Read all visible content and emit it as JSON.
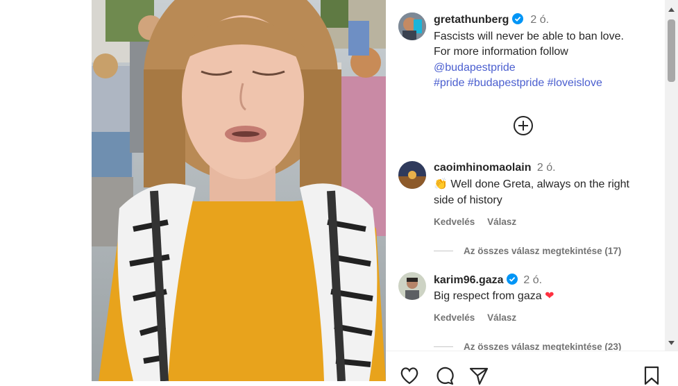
{
  "post": {
    "author": "gretathunberg",
    "time": "2 ó.",
    "caption_line1": "Fascists will never be able to ban love.",
    "caption_line2": "For more information follow",
    "mention": "@budapestpride",
    "hashtags": "#pride #budapestpride #loveislove"
  },
  "comments": [
    {
      "user": "caoimhinomaolain",
      "time": "2 ó.",
      "emoji": "👏",
      "text_line1": "Well done Greta, always on the right",
      "text_line2": "side of history",
      "like_label": "Kedvelés",
      "reply_label": "Válasz",
      "view_replies": "Az összes válasz megtekintése (17)"
    },
    {
      "user": "karim96.gaza",
      "time": "2 ó.",
      "text": "Big respect from gaza",
      "emoji": "❤",
      "like_label": "Kedvelés",
      "reply_label": "Válasz",
      "view_replies": "Az összes válasz megtekintése (23)"
    }
  ],
  "icons": {
    "load_more": "plus-circle-icon",
    "like": "heart-icon",
    "comment": "comment-icon",
    "share": "send-icon",
    "save": "bookmark-icon"
  },
  "colors": {
    "link": "#4a5ecf",
    "verified": "#0095f6",
    "heart": "#ff3040",
    "shirt": "#e8a31c"
  }
}
